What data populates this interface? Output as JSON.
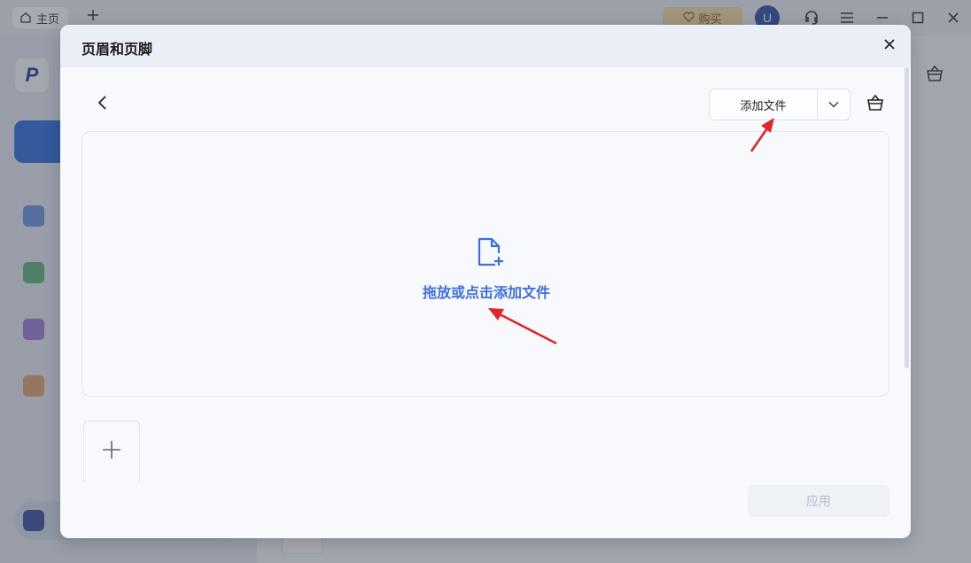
{
  "titlebar": {
    "home_tab_label": "主页",
    "buy_label": "购买",
    "avatar_letter": "U"
  },
  "background": {
    "logo_glyph": "P"
  },
  "dialog": {
    "title": "页眉和页脚",
    "add_file_label": "添加文件",
    "dropzone_text": "拖放或点击添加文件",
    "apply_label": "应用"
  },
  "colors": {
    "accent": "#3d6fe0",
    "annotation_arrow": "#e0262b",
    "buy_button": "#f4d9a3"
  },
  "icons": [
    "home-icon",
    "plus-icon",
    "heart-icon",
    "headset-icon",
    "menu-icon",
    "minimize-icon",
    "maximize-icon",
    "close-icon",
    "chevron-left-icon",
    "chevron-down-icon",
    "basket-icon",
    "file-add-icon"
  ]
}
